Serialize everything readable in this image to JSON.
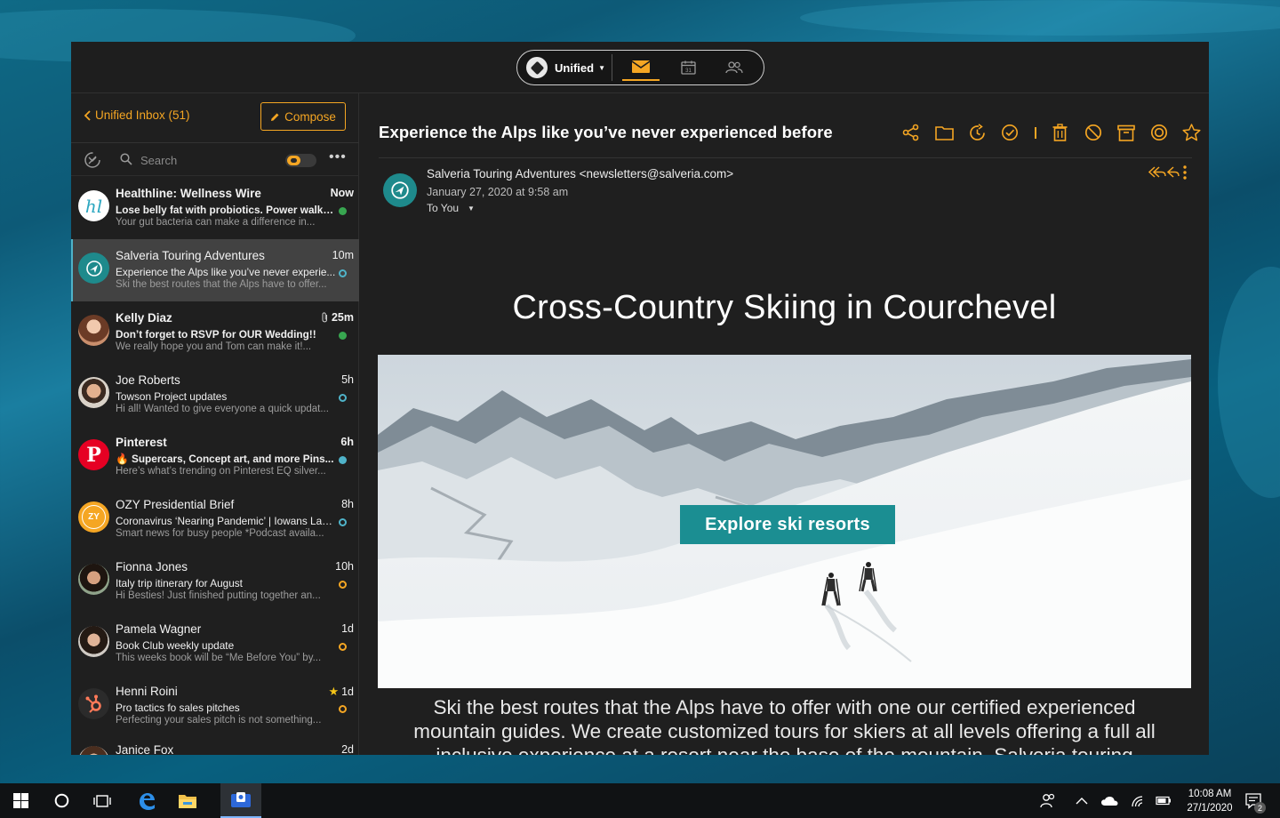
{
  "topbar": {
    "account_label": "Unified",
    "tabs": [
      {
        "name": "mail",
        "icon": "envelope-icon",
        "active": true
      },
      {
        "name": "calendar",
        "icon": "calendar-icon",
        "day": "31"
      },
      {
        "name": "people",
        "icon": "people-icon"
      }
    ]
  },
  "list": {
    "back_label": "Unified Inbox (51)",
    "compose_label": "Compose",
    "search_placeholder": "Search",
    "more_label": "•••",
    "messages": [
      {
        "from": "Healthline: Wellness Wire",
        "time": "Now",
        "subject": "Lose belly fat with probiotics. Power walking...",
        "preview": "Your gut bacteria can make a difference in...",
        "unread": true,
        "status": "green-dot",
        "avatar_text": "hl"
      },
      {
        "from": "Salveria Touring Adventures",
        "time": "10m",
        "subject": "Experience the Alps like you’ve never experie...",
        "preview": "Ski the best routes that the Alps have to offer...",
        "unread": false,
        "selected": true,
        "status": "blue-ring"
      },
      {
        "from": "Kelly Diaz",
        "time": "25m",
        "subject": "Don’t forget to RSVP for OUR Wedding!!",
        "preview": "We really hope you and Tom can make it!...",
        "unread": true,
        "status": "green-dot",
        "attachment": true
      },
      {
        "from": "Joe Roberts",
        "time": "5h",
        "subject": "Towson Project updates",
        "preview": "Hi all! Wanted to give everyone a quick updat...",
        "unread": false,
        "status": "blue-ring"
      },
      {
        "from": "Pinterest",
        "time": "6h",
        "subject": "Supercars, Concept art, and more Pins...",
        "preview": "Here’s what’s trending on Pinterest EQ silver...",
        "unread": true,
        "status": "blue-dot",
        "subject_emoji": "🔥",
        "avatar_text": "P"
      },
      {
        "from": "OZY Presidential Brief",
        "time": "8h",
        "subject": "Coronavirus ‘Nearing Pandemic’ | Iowans Lau...",
        "preview": "Smart news for busy people *Podcast availa...",
        "unread": false,
        "status": "blue-ring",
        "avatar_text": "ZY"
      },
      {
        "from": "Fionna Jones",
        "time": "10h",
        "subject": "Italy trip itinerary for August",
        "preview": "Hi Besties! Just finished putting together an...",
        "unread": false,
        "status": "orange-ring"
      },
      {
        "from": "Pamela Wagner",
        "time": "1d",
        "subject": "Book Club weekly update",
        "preview": "This weeks book will be “Me Before You” by...",
        "unread": false,
        "status": "orange-ring"
      },
      {
        "from": "Henni Roini",
        "time": "1d",
        "subject": "Pro tactics fo sales pitches",
        "preview": "Perfecting your sales pitch is not something...",
        "unread": false,
        "status": "orange-ring",
        "starred": true
      },
      {
        "from": "Janice Fox",
        "time": "2d",
        "subject": "",
        "preview": "",
        "unread": false,
        "status": "none"
      }
    ]
  },
  "reader": {
    "subject": "Experience the Alps like you’ve never experienced before",
    "sender_line": "Salveria Touring Adventures <newsletters@salveria.com>",
    "date": "January 27, 2020 at 9:58 am",
    "to_label": "To You",
    "actions": [
      "share-icon",
      "folder-icon",
      "snooze-icon",
      "done-icon",
      "trash-icon",
      "block-icon",
      "archive-icon",
      "target-icon",
      "star-icon"
    ],
    "email": {
      "heading": "Cross-Country Skiing in Courchevel",
      "cta_label": "Explore ski resorts",
      "body": "Ski the best routes that the Alps have to offer with one our certified experienced mountain guides. We create customized tours for skiers at all levels offering a full all inclusive experience at a resort near the base of the mountain. Salveria touring adventures is one of the most experienced"
    }
  },
  "taskbar": {
    "time": "10:08 AM",
    "date": "27/1/2020",
    "notification_count": "2"
  },
  "colors": {
    "accent": "#f5a623",
    "teal": "#1b8e92",
    "unread_green": "#38a650",
    "blue": "#4fb3c9"
  }
}
